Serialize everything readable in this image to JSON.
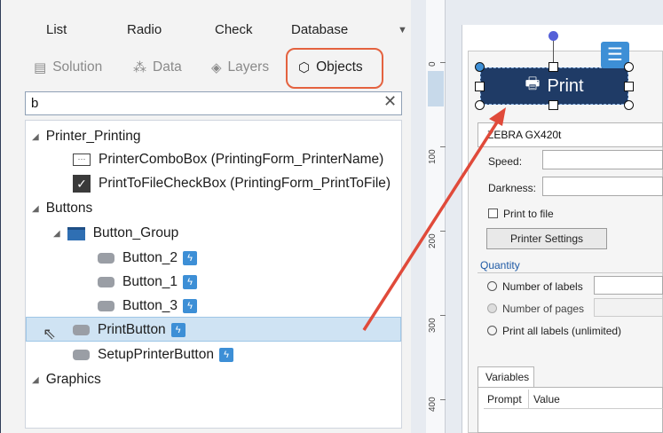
{
  "menu": {
    "items": [
      "List",
      "Radio",
      "Check",
      "Database"
    ]
  },
  "tabs": [
    {
      "label": "Solution",
      "icon": "solution-icon"
    },
    {
      "label": "Data",
      "icon": "data-icon"
    },
    {
      "label": "Layers",
      "icon": "layers-icon"
    },
    {
      "label": "Objects",
      "icon": "cube-icon"
    }
  ],
  "search": {
    "value": "b"
  },
  "tree": {
    "printer_printing": "Printer_Printing",
    "printer_combo": "PrinterComboBox (PrintingForm_PrinterName)",
    "print_to_file_check": "PrintToFileCheckBox (PrintingForm_PrintToFile)",
    "buttons": "Buttons",
    "button_group": "Button_Group",
    "button_2": "Button_2",
    "button_1": "Button_1",
    "button_3": "Button_3",
    "print_button": "PrintButton",
    "setup_printer_button": "SetupPrinterButton",
    "graphics": "Graphics"
  },
  "ruler": {
    "labels": [
      "0",
      "100",
      "200",
      "300",
      "400"
    ]
  },
  "form": {
    "print_label": "Print",
    "printer_name": "ZEBRA GX420t",
    "speed_label": "Speed:",
    "darkness_label": "Darkness:",
    "print_to_file": "Print to file",
    "printer_settings": "Printer Settings",
    "quantity": "Quantity",
    "number_of_labels": "Number of labels",
    "number_of_pages": "Number of pages",
    "print_all_labels": "Print all labels (unlimited)",
    "variables_tab": "Variables",
    "prompt_col": "Prompt",
    "value_col": "Value"
  },
  "colors": {
    "accent": "#3d8fd6",
    "highlight": "#e4623f",
    "print_button": "#1f3b66",
    "selection": "#cfe3f3"
  }
}
